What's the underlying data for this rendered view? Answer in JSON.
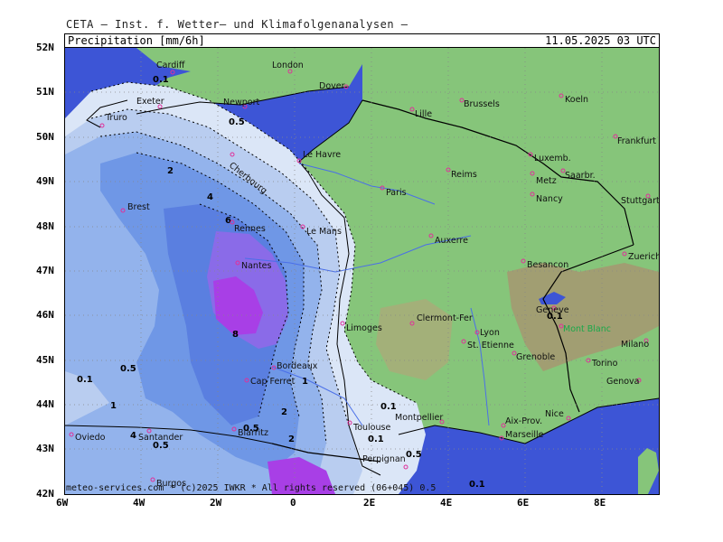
{
  "header": {
    "source": "CETA — Inst. f. Wetter— und Klimafolgenanalysen —",
    "product": "Precipitation [mm/6h]",
    "valid_time": "11.05.2025 03 UTC"
  },
  "footer": {
    "credit": "meteo-services.com * (c)2025 IWKR * All rights reserved (06+045) 0.5"
  },
  "axes": {
    "lat": [
      "52N",
      "51N",
      "50N",
      "49N",
      "48N",
      "47N",
      "46N",
      "45N",
      "44N",
      "43N",
      "42N"
    ],
    "lon": [
      "6W",
      "4W",
      "2W",
      "0",
      "2E",
      "4E",
      "6E",
      "8E"
    ]
  },
  "cities": [
    {
      "name": "Cardiff"
    },
    {
      "name": "London"
    },
    {
      "name": "Dover"
    },
    {
      "name": "Exeter"
    },
    {
      "name": "Newport"
    },
    {
      "name": "Truro"
    },
    {
      "name": "Lille"
    },
    {
      "name": "Brussels"
    },
    {
      "name": "Koeln"
    },
    {
      "name": "Frankfurt"
    },
    {
      "name": "Le Havre"
    },
    {
      "name": "Cherbourg"
    },
    {
      "name": "Reims"
    },
    {
      "name": "Luxemb."
    },
    {
      "name": "Metz"
    },
    {
      "name": "Saarbr."
    },
    {
      "name": "Paris"
    },
    {
      "name": "Nancy"
    },
    {
      "name": "Stuttgart"
    },
    {
      "name": "Brest"
    },
    {
      "name": "Rennes"
    },
    {
      "name": "Le Mans"
    },
    {
      "name": "Auxerre"
    },
    {
      "name": "Nantes"
    },
    {
      "name": "Besancon"
    },
    {
      "name": "Zuerich"
    },
    {
      "name": "Geneve"
    },
    {
      "name": "Limoges"
    },
    {
      "name": "Clermont-Fer"
    },
    {
      "name": "Lyon"
    },
    {
      "name": "St. Etienne"
    },
    {
      "name": "Mont Blanc"
    },
    {
      "name": "Milano"
    },
    {
      "name": "Grenoble"
    },
    {
      "name": "Torino"
    },
    {
      "name": "Bordeaux"
    },
    {
      "name": "Cap Ferret"
    },
    {
      "name": "Genova"
    },
    {
      "name": "Montpellier"
    },
    {
      "name": "Nice"
    },
    {
      "name": "Toulouse"
    },
    {
      "name": "Aix-Prov."
    },
    {
      "name": "Marseille"
    },
    {
      "name": "Biarritz"
    },
    {
      "name": "Perpignan"
    },
    {
      "name": "Oviedo"
    },
    {
      "name": "Santander"
    },
    {
      "name": "Burgos"
    }
  ],
  "contour_labels": [
    "0.1",
    "0.5",
    "1",
    "2",
    "4",
    "6",
    "8"
  ],
  "colors": {
    "sea": "#3d55d6",
    "land": "#86c57a",
    "precip_0_1": "#dbe6f7",
    "precip_0_5": "#b9cdf0",
    "precip_1": "#93b3ec",
    "precip_2": "#6f97e6",
    "precip_4": "#5a7fe0",
    "precip_6": "#8a6be8",
    "precip_8": "#a83fe6"
  }
}
